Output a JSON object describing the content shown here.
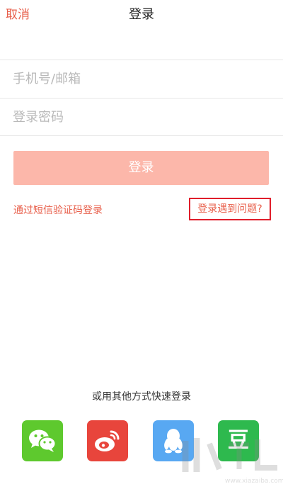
{
  "nav": {
    "cancel_label": "取消",
    "title": "登录"
  },
  "form": {
    "phone_placeholder": "手机号/邮箱",
    "phone_value": "",
    "password_placeholder": "登录密码",
    "password_value": ""
  },
  "login_button_label": "登录",
  "links": {
    "sms_login": "通过短信验证码登录",
    "login_problem": "登录遇到问题?"
  },
  "other_methods": {
    "label": "或用其他方式快速登录",
    "providers": [
      {
        "icon": "wechat-icon",
        "color": "#5ec92e"
      },
      {
        "icon": "weibo-icon",
        "color": "#e8453c"
      },
      {
        "icon": "qq-icon",
        "color": "#58a8f2"
      },
      {
        "icon": "douban-icon",
        "glyph": "豆",
        "color": "#2eb94e"
      }
    ]
  },
  "watermark": {
    "url": "www.xiazaiba.com"
  },
  "colors": {
    "accent": "#e8604c",
    "login_button_disabled": "#fcb7aa",
    "highlight_box": "#e01e2b"
  }
}
